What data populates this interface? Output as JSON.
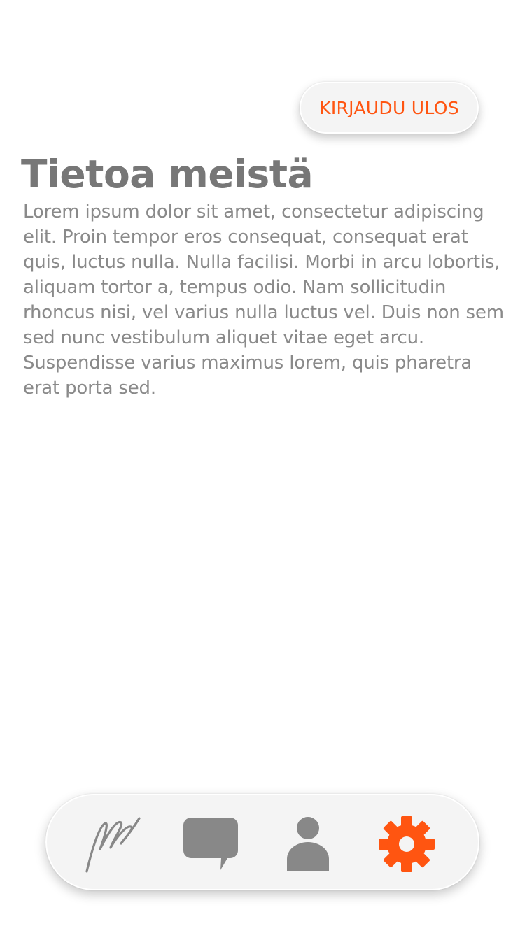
{
  "header": {
    "logout_label": "KIRJAUDU ULOS"
  },
  "about": {
    "title": "Tietoa meistä",
    "body": "Lorem ipsum dolor sit amet, consectetur adipiscing elit. Proin tempor eros consequat, consequat erat quis, luctus nulla. Nulla facilisi. Morbi in arcu lobortis, aliquam tortor a, tempus odio. Nam sollicitudin rhoncus nisi, vel varius nulla luctus vel. Duis non sem sed nunc vestibulum aliquet vitae eget arcu. Suspendisse varius maximus lorem, quis pharetra erat porta sed."
  },
  "bottom_nav": {
    "items": [
      {
        "icon": "signature-icon",
        "active": false
      },
      {
        "icon": "chat-bubble-icon",
        "active": false
      },
      {
        "icon": "user-icon",
        "active": false
      },
      {
        "icon": "gear-icon",
        "active": true
      }
    ]
  },
  "colors": {
    "accent": "#ff5511",
    "icon_inactive": "#888888",
    "title": "#777777",
    "body_text": "#8a8a8a",
    "pill_background": "#f4f4f4",
    "page_background": "#ffffff"
  }
}
